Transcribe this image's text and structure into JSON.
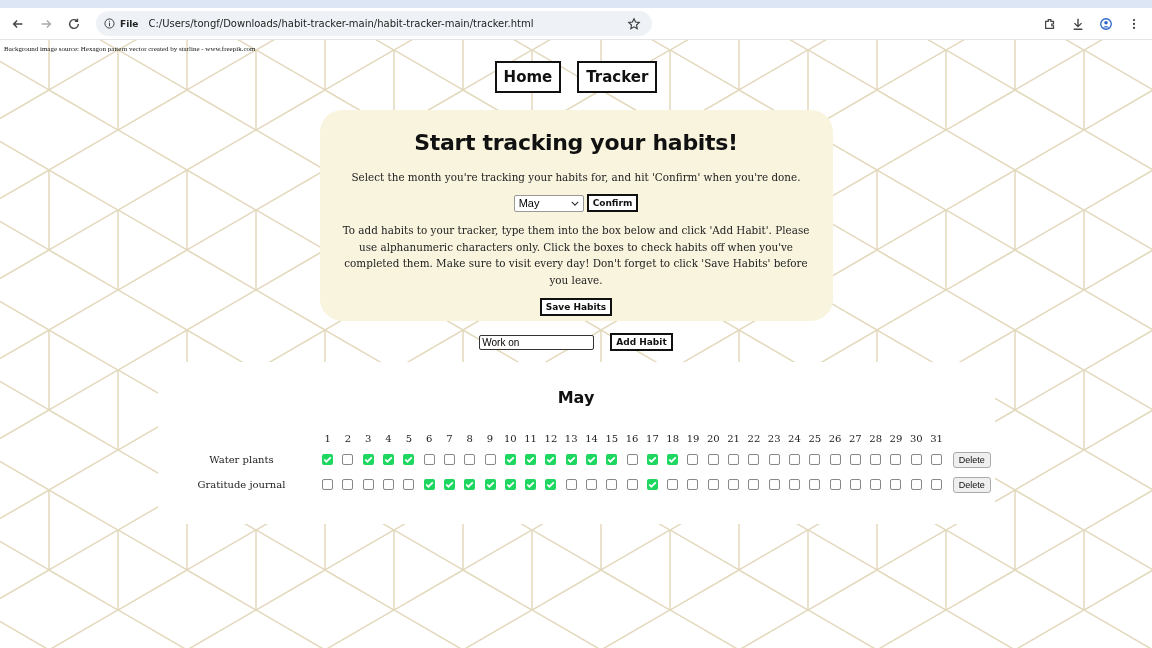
{
  "browser": {
    "file_label": "File",
    "url": "C:/Users/tongf/Downloads/habit-tracker-main/habit-tracker-main/tracker.html"
  },
  "attribution": "Background image source: Hexagon pattern vector created by starline - www.freepik.com",
  "nav": [
    {
      "label": "Home"
    },
    {
      "label": "Tracker"
    }
  ],
  "intro": {
    "title": "Start tracking your habits!",
    "instructions": "Select the month you're tracking your habits for, and hit 'Confirm' when you're done.",
    "month_select": {
      "value": "May"
    },
    "confirm_button": "Confirm",
    "help_text": "To add habits to your tracker, type them into the box below and click 'Add Habit'. Please use alphanumeric characters only. Click the boxes to check habits off when you've completed them. Make sure to visit every day! Don't forget to click 'Save Habits' before you leave.",
    "save_button": "Save Habits"
  },
  "add_habit": {
    "input": {
      "value": "Work on"
    },
    "button": "Add Habit"
  },
  "tracker": {
    "month": "May",
    "day_numbers": [
      "1",
      "2",
      "3",
      "4",
      "5",
      "6",
      "7",
      "8",
      "9",
      "10",
      "11",
      "12",
      "13",
      "14",
      "15",
      "16",
      "17",
      "18",
      "19",
      "20",
      "21",
      "22",
      "23",
      "24",
      "25",
      "26",
      "27",
      "28",
      "29",
      "30",
      "31"
    ],
    "habits": [
      {
        "name": "Water plants",
        "delete_button": "Delete",
        "days": [
          {
            "checked": true
          },
          {
            "checked": false
          },
          {
            "checked": true
          },
          {
            "checked": true
          },
          {
            "checked": true
          },
          {
            "checked": false
          },
          {
            "checked": false
          },
          {
            "checked": false
          },
          {
            "checked": false
          },
          {
            "checked": true
          },
          {
            "checked": true
          },
          {
            "checked": true
          },
          {
            "checked": true
          },
          {
            "checked": true
          },
          {
            "checked": true
          },
          {
            "checked": false
          },
          {
            "checked": true
          },
          {
            "checked": true
          },
          {
            "checked": false
          },
          {
            "checked": false
          },
          {
            "checked": false
          },
          {
            "checked": false
          },
          {
            "checked": false
          },
          {
            "checked": false
          },
          {
            "checked": false
          },
          {
            "checked": false
          },
          {
            "checked": false
          },
          {
            "checked": false
          },
          {
            "checked": false
          },
          {
            "checked": false
          },
          {
            "checked": false
          }
        ]
      },
      {
        "name": "Gratitude journal",
        "delete_button": "Delete",
        "days": [
          {
            "checked": false
          },
          {
            "checked": false
          },
          {
            "checked": false
          },
          {
            "checked": false
          },
          {
            "checked": false
          },
          {
            "checked": true
          },
          {
            "checked": true
          },
          {
            "checked": true
          },
          {
            "checked": true
          },
          {
            "checked": true
          },
          {
            "checked": true
          },
          {
            "checked": true
          },
          {
            "checked": false
          },
          {
            "checked": false
          },
          {
            "checked": false
          },
          {
            "checked": false
          },
          {
            "checked": true
          },
          {
            "checked": false
          },
          {
            "checked": false
          },
          {
            "checked": false
          },
          {
            "checked": false
          },
          {
            "checked": false
          },
          {
            "checked": false
          },
          {
            "checked": false
          },
          {
            "checked": false
          },
          {
            "checked": false
          },
          {
            "checked": false
          },
          {
            "checked": false
          },
          {
            "checked": false
          },
          {
            "checked": false
          },
          {
            "checked": false
          }
        ]
      }
    ]
  }
}
